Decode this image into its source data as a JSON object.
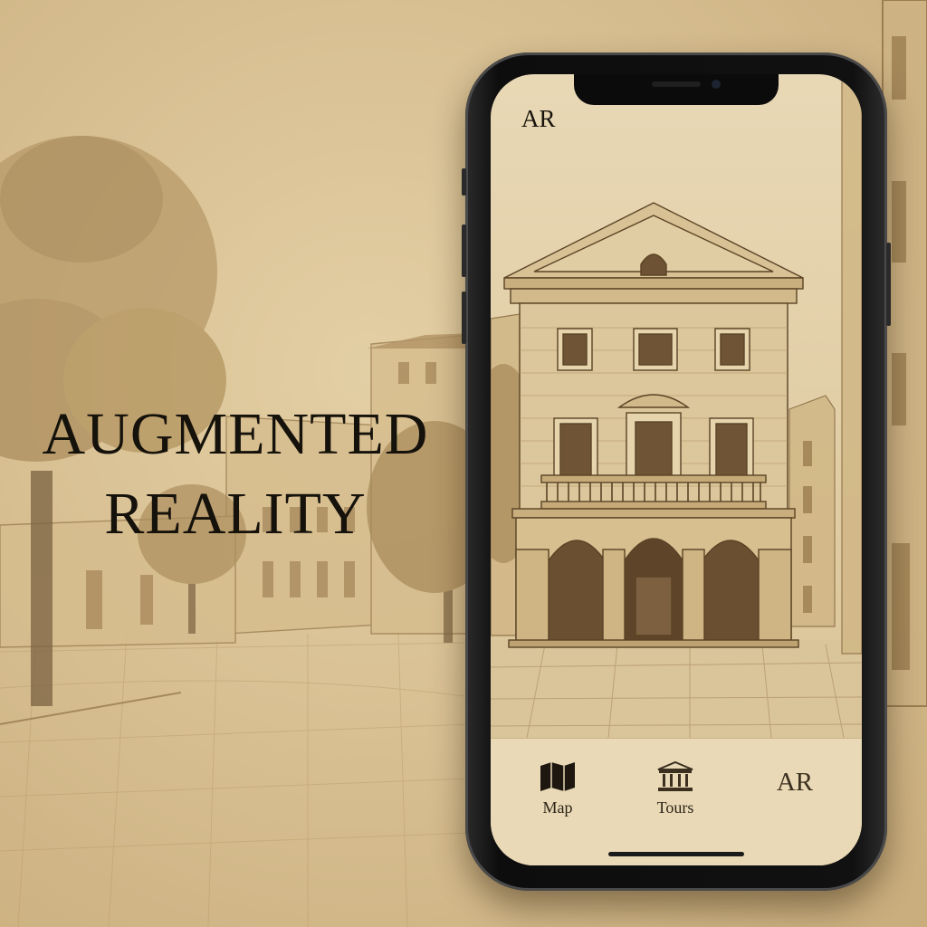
{
  "headline": {
    "line1": "AUGMENTED",
    "line2": "REALITY"
  },
  "app": {
    "corner_label": "AR",
    "tabs": [
      {
        "label": "Map",
        "icon": "map-icon"
      },
      {
        "label": "Tours",
        "icon": "museum-icon"
      },
      {
        "label": "",
        "icon": "ar-text-icon",
        "glyph": "AR"
      }
    ]
  },
  "colors": {
    "parchment": "#e3cfa4",
    "ink": "#15110b",
    "sepia": "#6b5230"
  }
}
